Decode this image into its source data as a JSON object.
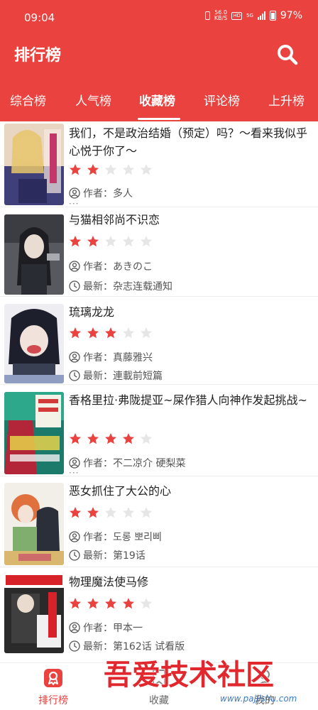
{
  "status_bar": {
    "time": "09:04",
    "net_speed_value": "56.0",
    "net_speed_unit": "KB/S",
    "hd": "HD",
    "signal_label": "5G",
    "battery": "97%"
  },
  "header": {
    "title": "排行榜"
  },
  "tabs": [
    {
      "label": "综合榜"
    },
    {
      "label": "人气榜"
    },
    {
      "label": "收藏榜",
      "active": true
    },
    {
      "label": "评论榜"
    },
    {
      "label": "上升榜"
    }
  ],
  "labels": {
    "author_prefix": "作者：",
    "latest_prefix": "最新：",
    "more": "···"
  },
  "items": [
    {
      "title": "我们，不是政治结婚（预定）吗？～看来我似乎心悦于你了～",
      "rating": 2,
      "author": "多人",
      "latest": null
    },
    {
      "title": "与猫相邻尚不识恋",
      "rating": 2,
      "author": "あきのこ",
      "latest": "杂志连载通知"
    },
    {
      "title": "琉璃龙龙",
      "rating": 3,
      "author": "真藤雅兴",
      "latest": "連載前短篇"
    },
    {
      "title": "香格里拉·弗陇提亚~屎作猎人向神作发起挑战~",
      "rating": 4,
      "author": "不二凉介 硬梨菜",
      "latest": null
    },
    {
      "title": "恶女抓住了大公的心",
      "rating": 2,
      "author": "도롱 뽀리삐",
      "latest": "第19话"
    },
    {
      "title": "物理魔法使马修",
      "rating": 4,
      "author": "甲本一",
      "latest": "第162话 试看版"
    }
  ],
  "bottom_nav": [
    {
      "label": "排行榜",
      "icon": "ranking-icon",
      "active": true
    },
    {
      "label": "收藏",
      "icon": "bookmark-icon",
      "active": false
    },
    {
      "label": "我的",
      "icon": "user-icon",
      "active": false
    }
  ],
  "watermark": {
    "text": "吾爱技术社区",
    "url": "www.pajjishu.com"
  },
  "colors": {
    "primary": "#e9423f",
    "star_on": "#e9423f",
    "star_off": "#e6e6e6"
  }
}
